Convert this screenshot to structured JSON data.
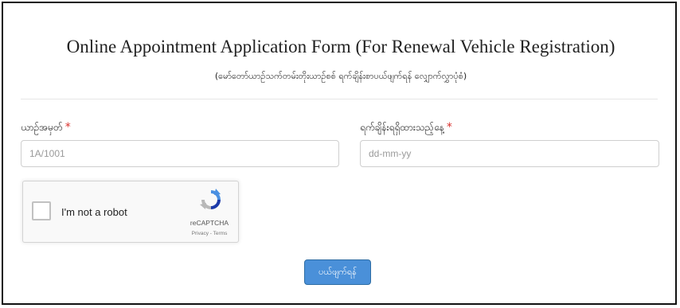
{
  "form": {
    "title": "Online Appointment Application Form (For Renewal Vehicle Registration)",
    "subtitle": "(မော်တော်ယာဉ်သက်တမ်းတိုးယာဉ်စစ် ရက်ချိန်းစာပယ်ဖျက်ရန် လျှောက်လွှာပုံစံ)"
  },
  "fields": {
    "vehicle_number": {
      "label": "ယာဉ်အမှတ်",
      "required_mark": "*",
      "placeholder": "1A/1001",
      "value": ""
    },
    "appointment_date": {
      "label": "ရက်ချိန်းရရှိထားသည့်နေ့",
      "required_mark": "*",
      "placeholder": "dd-mm-yy",
      "value": ""
    }
  },
  "recaptcha": {
    "checkbox_label": "I'm not a robot",
    "brand": "reCAPTCHA",
    "privacy_link": "Privacy",
    "separator": " - ",
    "terms_link": "Terms",
    "icon": "recaptcha-logo-icon",
    "colors": {
      "blue": "#4a90e2",
      "dark_blue": "#1c3aa9",
      "gray": "#b8b8b8"
    }
  },
  "submit": {
    "label": "ပယ်ဖျက်ရန်",
    "color": "#4a90d9"
  }
}
